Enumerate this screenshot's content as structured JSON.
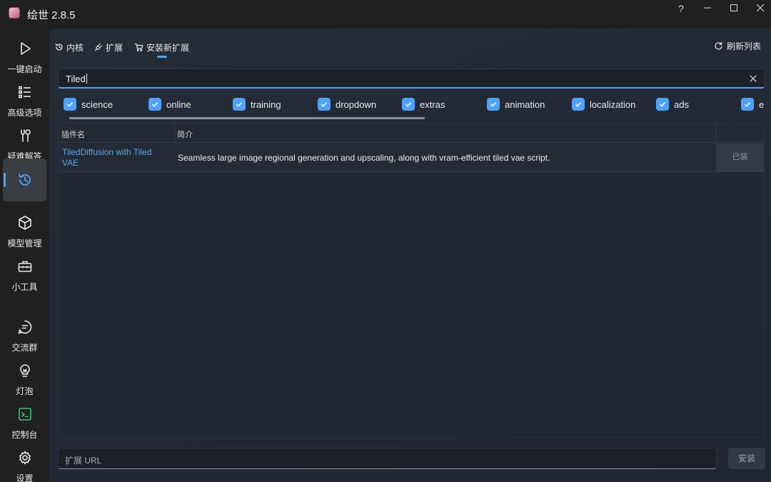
{
  "window": {
    "title": "绘世 2.8.5",
    "help": "?"
  },
  "sidebar": {
    "items": [
      {
        "label": "一键启动",
        "icon": "play-icon"
      },
      {
        "label": "高级选项",
        "icon": "list-icon"
      },
      {
        "label": "疑难解答",
        "icon": "tools-icon"
      },
      {
        "label": "",
        "icon": "history-icon",
        "active": true
      },
      {
        "label": "模型管理",
        "icon": "cube-icon"
      },
      {
        "label": "小工具",
        "icon": "toolbox-icon"
      },
      {
        "label": "交流群",
        "icon": "chat-icon"
      },
      {
        "label": "灯泡",
        "icon": "lightbulb-icon"
      },
      {
        "label": "控制台",
        "icon": "terminal-icon"
      },
      {
        "label": "设置",
        "icon": "gear-icon"
      }
    ]
  },
  "tabs": [
    {
      "label": "内核",
      "icon": "history-icon"
    },
    {
      "label": "扩展",
      "icon": "plug-icon"
    },
    {
      "label": "安装新扩展",
      "icon": "cart-icon",
      "active": true
    }
  ],
  "refresh_label": "刷新列表",
  "search": {
    "value": "Tiled"
  },
  "tags": [
    "science",
    "online",
    "training",
    "dropdown",
    "extras",
    "animation",
    "localization",
    "ads",
    "e"
  ],
  "table": {
    "headers": {
      "name": "插件名",
      "desc": "简介"
    },
    "rows": [
      {
        "name": "TiledDiffusion with Tiled VAE",
        "desc": "Seamless large image regional generation and upscaling, along with vram-efficient tiled vae script.",
        "action": "已装"
      }
    ]
  },
  "url_input": {
    "placeholder": "扩展 URL"
  },
  "install_label": "安装",
  "colors": {
    "accent": "#4da3ff",
    "link": "#4ea6f5",
    "terminal_icon": "#3fbf74"
  }
}
